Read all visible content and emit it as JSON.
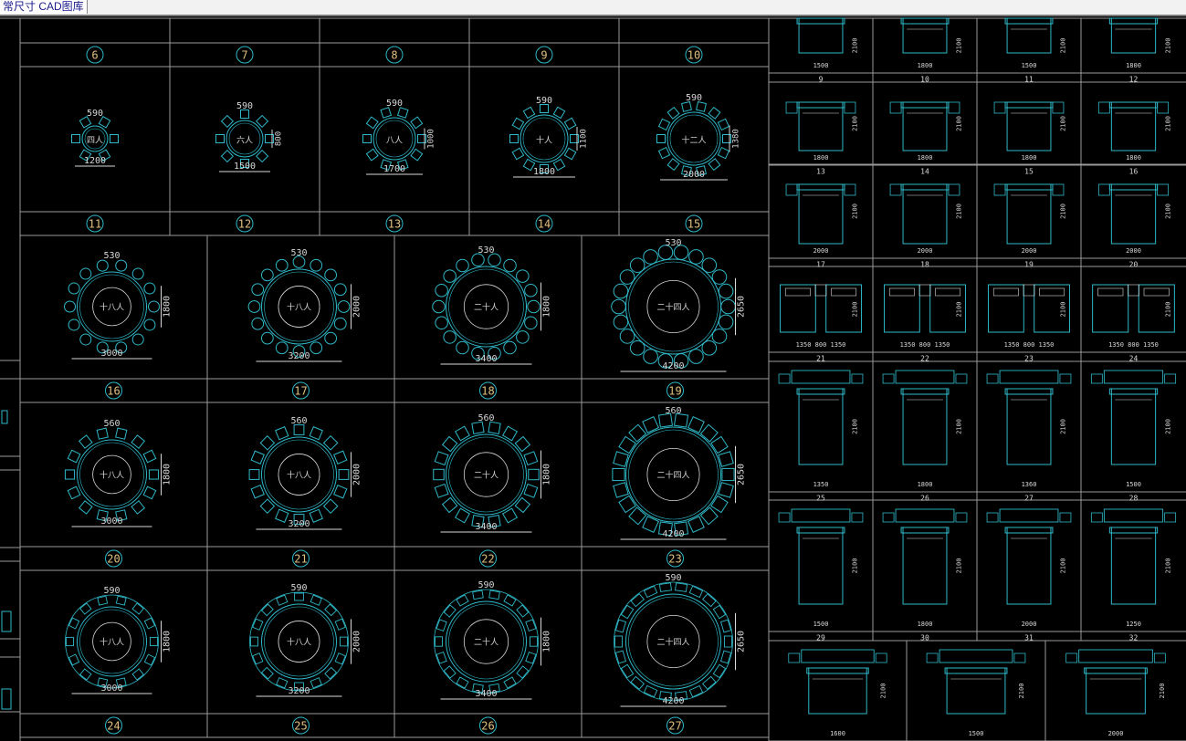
{
  "app": {
    "tab_title": "常尺寸 CAD图库"
  },
  "colors": {
    "background": "#000000",
    "grid_line": "#9a9a9a",
    "furniture": "#2fb8c8",
    "dimension": "#d8d8d8",
    "label_text": "#e0c080"
  },
  "left_panel": {
    "header_row": [
      "6",
      "7",
      "8",
      "9",
      "10"
    ],
    "row1": {
      "tables": [
        {
          "chair_width": "590",
          "diameter": "1200",
          "size": "",
          "name": "四人"
        },
        {
          "chair_width": "590",
          "diameter": "1500",
          "size": "800",
          "name": "六人"
        },
        {
          "chair_width": "590",
          "diameter": "1700",
          "size": "1000",
          "name": "八人"
        },
        {
          "chair_width": "590",
          "diameter": "1800",
          "size": "1100",
          "name": "十人"
        },
        {
          "chair_width": "590",
          "diameter": "2000",
          "size": "1380",
          "name": "十二人"
        }
      ],
      "numbers": [
        "11",
        "12",
        "13",
        "14",
        "15"
      ]
    },
    "row2": {
      "tables": [
        {
          "chair_width": "530",
          "diameter": "3000",
          "size": "1800",
          "name": "十八人"
        },
        {
          "chair_width": "530",
          "diameter": "3200",
          "size": "2000",
          "name": "十八人"
        },
        {
          "chair_width": "530",
          "diameter": "3400",
          "size": "1800",
          "name": "二十人"
        },
        {
          "chair_width": "530",
          "diameter": "4200",
          "size": "2650",
          "name": "二十四人"
        }
      ],
      "numbers": [
        "16",
        "17",
        "18",
        "19"
      ]
    },
    "row3": {
      "tables": [
        {
          "chair_width": "560",
          "diameter": "3000",
          "size": "1800",
          "name": "十八人"
        },
        {
          "chair_width": "560",
          "diameter": "3200",
          "size": "2000",
          "name": "十八人"
        },
        {
          "chair_width": "560",
          "diameter": "3400",
          "size": "1800",
          "name": "二十人"
        },
        {
          "chair_width": "560",
          "diameter": "4200",
          "size": "2650",
          "name": "二十四人"
        }
      ],
      "numbers": [
        "20",
        "21",
        "22",
        "23"
      ]
    },
    "row4": {
      "tables": [
        {
          "chair_width": "590",
          "diameter": "3000",
          "size": "1800",
          "name": "十八人"
        },
        {
          "chair_width": "590",
          "diameter": "3200",
          "size": "2000",
          "name": "十八人"
        },
        {
          "chair_width": "590",
          "diameter": "3400",
          "size": "1800",
          "name": "二十人"
        },
        {
          "chair_width": "590",
          "diameter": "4200",
          "size": "2650",
          "name": "二十四人"
        }
      ],
      "numbers": [
        "24",
        "25",
        "26",
        "27"
      ]
    }
  },
  "right_panel": {
    "rows": [
      {
        "widths": [
          "1500",
          "1800",
          "1500",
          "1800"
        ],
        "depth": "2100",
        "numbers": [
          "9",
          "10",
          "11",
          "12"
        ]
      },
      {
        "widths": [
          "1800",
          "1800",
          "1800",
          "1800"
        ],
        "depth": "2100",
        "numbers": [
          "13",
          "14",
          "15",
          "16"
        ]
      },
      {
        "widths": [
          "2000",
          "2000",
          "2000",
          "2000"
        ],
        "depth": "2100",
        "numbers": [
          "17",
          "18",
          "19",
          "20"
        ]
      },
      {
        "widths": [
          "1350  800  1350",
          "1350  800  1350",
          "1350  800  1350",
          "1350  800  1350"
        ],
        "depth": "2100",
        "numbers": [
          "21",
          "22",
          "23",
          "24"
        ]
      },
      {
        "widths": [
          "1350",
          "1800",
          "1360",
          "1500"
        ],
        "depth": "2100",
        "numbers": [
          "25",
          "26",
          "27",
          "28"
        ]
      },
      {
        "widths": [
          "1500",
          "1800",
          "2000",
          "1250"
        ],
        "depth": "2100",
        "numbers": [
          "29",
          "30",
          "31",
          "32"
        ]
      },
      {
        "widths": [
          "1600",
          "1500",
          "2000"
        ],
        "depth": "2100",
        "numbers": []
      }
    ]
  }
}
